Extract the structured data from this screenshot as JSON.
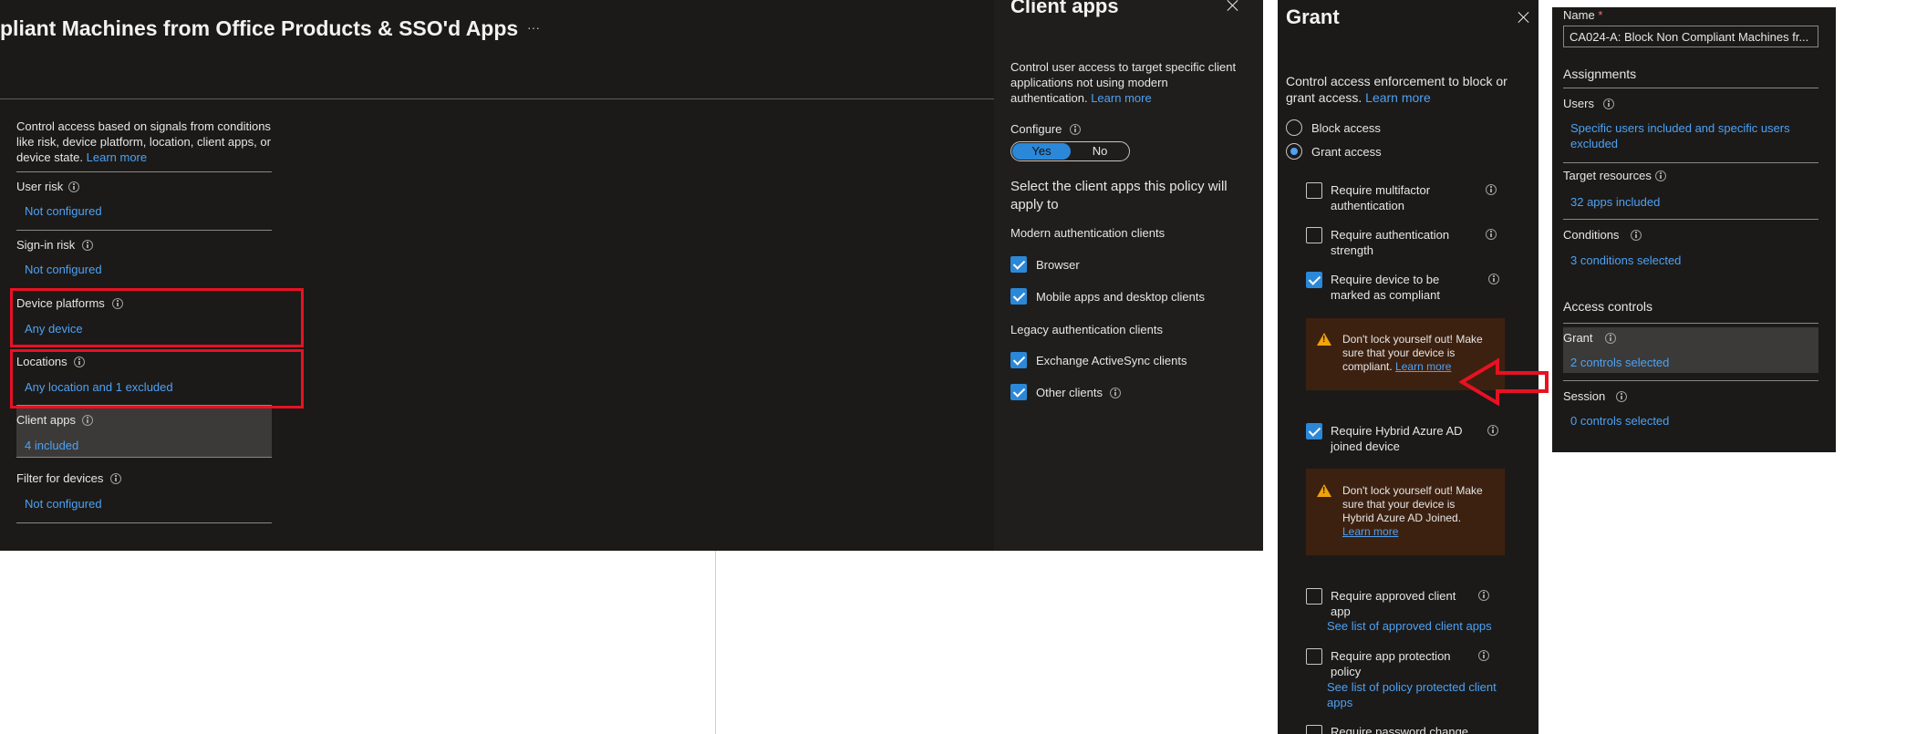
{
  "policy": {
    "title": "pliant Machines from Office Products & SSO'd Apps",
    "more_label": "···",
    "intro": "Control access based on signals from conditions like risk, device platform, location, client apps, or device state.",
    "intro_link": "Learn more",
    "conditions": [
      {
        "label": "User risk",
        "value": "Not configured"
      },
      {
        "label": "Sign-in risk",
        "value": "Not configured"
      },
      {
        "label": "Device platforms",
        "value": "Any device"
      },
      {
        "label": "Locations",
        "value": "Any location and 1 excluded"
      },
      {
        "label": "Client apps",
        "value": "4 included"
      },
      {
        "label": "Filter for devices",
        "value": "Not configured"
      }
    ]
  },
  "client_apps": {
    "title": "Client apps",
    "description": "Control user access to target specific client applications not using modern authentication.",
    "learn_more": "Learn more",
    "configure_label": "Configure",
    "toggle_yes": "Yes",
    "toggle_no": "No",
    "select_text": "Select the client apps this policy will apply to",
    "modern_header": "Modern authentication clients",
    "browser": "Browser",
    "mobile": "Mobile apps and desktop clients",
    "legacy_header": "Legacy authentication clients",
    "exchange": "Exchange ActiveSync clients",
    "other": "Other clients"
  },
  "grant": {
    "title": "Grant",
    "description": "Control access enforcement to block or grant access.",
    "learn_more": "Learn more",
    "block_access": "Block access",
    "grant_access": "Grant access",
    "mfa_1": "Require multifactor",
    "mfa_2": "authentication",
    "strength_1": "Require authentication",
    "strength_2": "strength",
    "compliant_1": "Require device to be",
    "compliant_2": "marked as compliant",
    "warn1_1": "Don't lock yourself out! Make",
    "warn1_2": "sure that your device is",
    "warn1_3": "compliant.",
    "warn_link": "Learn more",
    "hybrid_1": "Require Hybrid Azure AD",
    "hybrid_2": "joined device",
    "warn2_1": "Don't lock yourself out! Make",
    "warn2_2": "sure that your device is",
    "warn2_3": "Hybrid Azure AD Joined.",
    "approved_1": "Require approved client",
    "approved_2": "app",
    "approved_link": "See list of approved client apps",
    "protection_1": "Require app protection",
    "protection_2": "policy",
    "protection_link_1": "See list of policy protected client",
    "protection_link_2": "apps",
    "password_change": "Require password change"
  },
  "summary": {
    "name_label": "Name",
    "required_mark": "*",
    "name_value": "CA024-A: Block Non Compliant Machines fr...",
    "assignments_header": "Assignments",
    "users_label": "Users",
    "users_value_1": "Specific users included and specific users",
    "users_value_2": "excluded",
    "target_label": "Target resources",
    "target_value": "32 apps included",
    "conditions_label": "Conditions",
    "conditions_value": "3 conditions selected",
    "access_header": "Access controls",
    "grant_label": "Grant",
    "grant_value": "2 controls selected",
    "session_label": "Session",
    "session_value": "0 controls selected"
  },
  "colors": {
    "panel_bg": "#1b1a19",
    "link": "#4ea1f3",
    "checkbox_on": "#2b88d8",
    "highlight_red": "#e81123",
    "warning_bg": "#3d2110",
    "warning_icon": "#f0a30a"
  }
}
